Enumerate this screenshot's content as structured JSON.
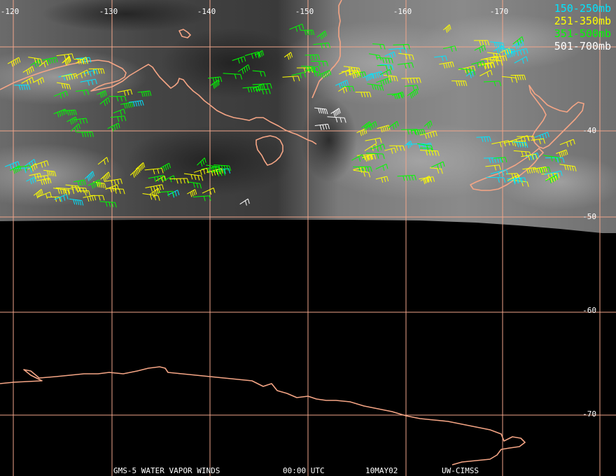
{
  "map": {
    "longitude_labels": [
      "-120",
      "-130",
      "-140",
      "-150",
      "-160",
      "-170"
    ],
    "latitude_labels": [
      "-40",
      "-50",
      "-60",
      "-70"
    ],
    "colors": {
      "background": "#000000",
      "grid": "#f0a58a",
      "coast": "#f5a585",
      "imagery_light": "#8c8c8c",
      "imagery_dark": "#3a3a3a"
    },
    "legend": [
      {
        "label": "150-250mb",
        "color": "#00e5ff"
      },
      {
        "label": "251-350mb",
        "color": "#ffff00"
      },
      {
        "label": "351-500mb",
        "color": "#00ff00"
      },
      {
        "label": "501-700mb",
        "color": "#ffffff"
      }
    ]
  },
  "footer": {
    "product": "GMS-5 WATER VAPOR WINDS",
    "time": "00:00 UTC",
    "date": "10MAY02",
    "source": "UW-CIMSS"
  }
}
